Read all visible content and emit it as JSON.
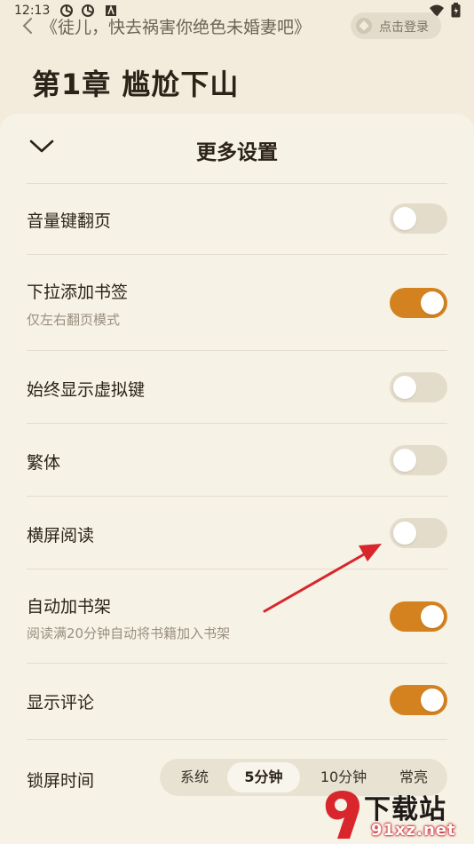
{
  "status_bar": {
    "time": "12:13",
    "left_icons": [
      "sync-icon",
      "sync-icon",
      "notification-a-icon"
    ],
    "right_icons": [
      "wifi-icon",
      "battery-icon"
    ]
  },
  "header": {
    "book_title": "《徒儿，快去祸害你绝色未婚妻吧》",
    "login_label": "点击登录",
    "chapter_title": "第1章 尴尬下山"
  },
  "sheet": {
    "title": "更多设置",
    "settings": [
      {
        "label": "音量键翻页",
        "sub": "",
        "on": false
      },
      {
        "label": "下拉添加书签",
        "sub": "仅左右翻页模式",
        "on": true
      },
      {
        "label": "始终显示虚拟键",
        "sub": "",
        "on": false
      },
      {
        "label": "繁体",
        "sub": "",
        "on": false
      },
      {
        "label": "横屏阅读",
        "sub": "",
        "on": false
      },
      {
        "label": "自动加书架",
        "sub": "阅读满20分钟自动将书籍加入书架",
        "on": true
      },
      {
        "label": "显示评论",
        "sub": "",
        "on": true
      }
    ],
    "lock_screen": {
      "label": "锁屏时间",
      "options": [
        "系统",
        "5分钟",
        "10分钟",
        "常亮"
      ],
      "selected": "5分钟"
    }
  },
  "colors": {
    "accent": "#d4821f",
    "background": "#f3ecdc",
    "sheet": "#f6f2e6",
    "toggle_off": "#e3dccb",
    "annotation_arrow": "#d8262c"
  },
  "watermark": {
    "top": "下载站",
    "bottom": "91xz.net"
  }
}
